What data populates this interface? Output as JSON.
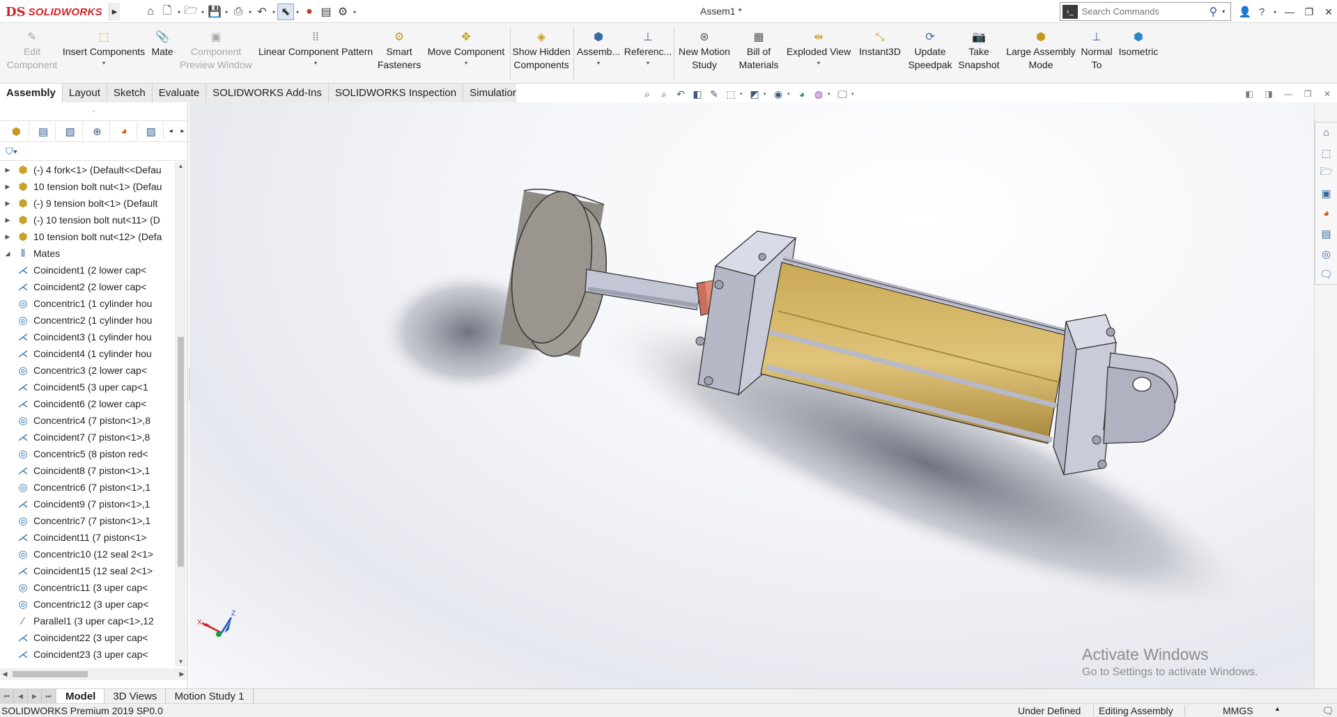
{
  "app": {
    "brand": "SOLIDWORKS",
    "document_title": "Assem1 *"
  },
  "search": {
    "placeholder": "Search Commands"
  },
  "command_manager": {
    "buttons": [
      {
        "label1": "Edit",
        "label2": "Component",
        "icon": "edit-component-icon"
      },
      {
        "label1": "Insert Components",
        "label2": "",
        "icon": "insert-components-icon"
      },
      {
        "label1": "Mate",
        "label2": "",
        "icon": "mate-icon"
      },
      {
        "label1": "Component",
        "label2": "Preview Window",
        "icon": "component-preview-icon"
      },
      {
        "label1": "Linear Component Pattern",
        "label2": "",
        "icon": "linear-pattern-icon"
      },
      {
        "label1": "Smart",
        "label2": "Fasteners",
        "icon": "smart-fasteners-icon"
      },
      {
        "label1": "Move Component",
        "label2": "",
        "icon": "move-component-icon"
      },
      {
        "label1": "Show Hidden",
        "label2": "Components",
        "icon": "show-hidden-icon"
      },
      {
        "label1": "Assemb...",
        "label2": "",
        "icon": "assembly-features-icon"
      },
      {
        "label1": "Referenc...",
        "label2": "",
        "icon": "reference-geometry-icon"
      },
      {
        "label1": "New Motion",
        "label2": "Study",
        "icon": "motion-study-icon"
      },
      {
        "label1": "Bill of",
        "label2": "Materials",
        "icon": "bom-icon"
      },
      {
        "label1": "Exploded View",
        "label2": "",
        "icon": "exploded-view-icon"
      },
      {
        "label1": "Instant3D",
        "label2": "",
        "icon": "instant3d-icon"
      },
      {
        "label1": "Update",
        "label2": "Speedpak",
        "icon": "speedpak-icon"
      },
      {
        "label1": "Take",
        "label2": "Snapshot",
        "icon": "snapshot-icon"
      },
      {
        "label1": "Large Assembly",
        "label2": "Mode",
        "icon": "large-assembly-icon"
      },
      {
        "label1": "Normal",
        "label2": "To",
        "icon": "normal-to-icon"
      },
      {
        "label1": "Isometric",
        "label2": "",
        "icon": "isometric-icon"
      }
    ]
  },
  "tabs": [
    "Assembly",
    "Layout",
    "Sketch",
    "Evaluate",
    "SOLIDWORKS Add-Ins",
    "SOLIDWORKS Inspection",
    "Simulation"
  ],
  "tree": {
    "components": [
      "(-) 4 fork<1> (Default<<Defau",
      "10 tension bolt nut<1> (Defau",
      "(-) 9 tension bolt<1> (Default",
      "(-) 10 tension bolt nut<11> (D",
      "10 tension bolt nut<12> (Defa"
    ],
    "mates_label": "Mates",
    "mates": [
      {
        "type": "coincident",
        "label": "Coincident1 (2 lower cap<"
      },
      {
        "type": "coincident",
        "label": "Coincident2 (2 lower cap<"
      },
      {
        "type": "concentric",
        "label": "Concentric1 (1 cylinder hou"
      },
      {
        "type": "concentric",
        "label": "Concentric2 (1 cylinder hou"
      },
      {
        "type": "coincident",
        "label": "Coincident3 (1 cylinder hou"
      },
      {
        "type": "coincident",
        "label": "Coincident4 (1 cylinder hou"
      },
      {
        "type": "concentric",
        "label": "Concentric3 (2 lower cap<"
      },
      {
        "type": "coincident",
        "label": "Coincident5 (3 uper cap<1"
      },
      {
        "type": "coincident",
        "label": "Coincident6 (2 lower cap<"
      },
      {
        "type": "concentric",
        "label": "Concentric4 (7 piston<1>,8"
      },
      {
        "type": "coincident",
        "label": "Coincident7 (7 piston<1>,8"
      },
      {
        "type": "concentric",
        "label": "Concentric5 (8 piston red<"
      },
      {
        "type": "coincident",
        "label": "Coincident8 (7 piston<1>,1"
      },
      {
        "type": "concentric",
        "label": "Concentric6 (7 piston<1>,1"
      },
      {
        "type": "coincident",
        "label": "Coincident9 (7 piston<1>,1"
      },
      {
        "type": "concentric",
        "label": "Concentric7 (7 piston<1>,1"
      },
      {
        "type": "coincident",
        "label": "Coincident11 (7 piston<1>"
      },
      {
        "type": "concentric",
        "label": "Concentric10 (12 seal 2<1>"
      },
      {
        "type": "coincident",
        "label": "Coincident15 (12 seal 2<1>"
      },
      {
        "type": "concentric",
        "label": "Concentric11 (3 uper cap<"
      },
      {
        "type": "concentric",
        "label": "Concentric12 (3 uper cap<"
      },
      {
        "type": "parallel",
        "label": "Parallel1 (3 uper cap<1>,12"
      },
      {
        "type": "coincident",
        "label": "Coincident22 (3 uper cap<"
      },
      {
        "type": "coincident",
        "label": "Coincident23 (3 uper cap<"
      }
    ]
  },
  "triad": {
    "x": "X",
    "z": "Z"
  },
  "watermark": {
    "line1": "Activate Windows",
    "line2": "Go to Settings to activate Windows."
  },
  "bottom_tabs": [
    "Model",
    "3D Views",
    "Motion Study 1"
  ],
  "status": {
    "product": "SOLIDWORKS Premium 2019 SP0.0",
    "state": "Under Defined",
    "mode": "Editing Assembly",
    "units": "MMGS"
  }
}
